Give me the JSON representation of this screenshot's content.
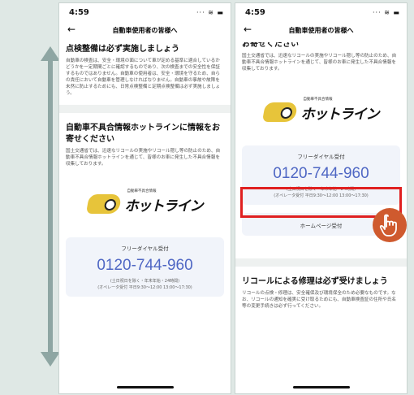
{
  "left_screen": {
    "status_time": "4:59",
    "nav_title": "自動車使用者の皆様へ",
    "section1_title": "点検整備は必ず実施しましょう",
    "section1_body": "自動車の検査は、安全・環境の面について車が定める基準に適合しているかどうかを一定期間ごとに確認するものであり、次の検査までの安全性を保証するものではありません。自動車の使用者は、安全・環境を守るため、自らの責任において自動車を管理しなければなりません。自動車の事故や故障を未然に防止するためにも、日常点検整備と定期点検整備は必ず実施しましょう。",
    "section2_title": "自動車不具合情報ホットラインに情報をお寄せください",
    "section2_body": "国土交通省では、迅速なリコールの実施やリコール隠し等の防止のため、自動車不具合情報ホットラインを通じて、皆様のお車に発生した不具合情報を収集しております。",
    "logo_small": "自動車不具合情報",
    "logo_main": "ホットライン",
    "card_label": "フリーダイヤル受付",
    "phone_number": "0120-744-960",
    "hours_line1": "(土日祝日を除く・年末年始・24時間)",
    "hours_line2": "(オペレータ受付 平日9:30〜12:00 13:00〜17:30)"
  },
  "right_screen": {
    "status_time": "4:59",
    "nav_title": "自動車使用者の皆様へ",
    "top_title": "お寄せください",
    "top_body": "国土交通省では、迅速なリコールの実施やリコール隠し等の防止のため、自動車不具合情報ホットラインを通じて、皆様のお車に発生した不具合情報を収集しております。",
    "logo_small": "自動車不具合情報",
    "logo_main": "ホットライン",
    "card_label": "フリーダイヤル受付",
    "phone_number": "0120-744-960",
    "hours_line1": "(土日祝日を除く・年末年始・24時間)",
    "hours_line2": "(オペレータ受付 平日9:30〜12:00 13:00〜17:30)",
    "home_button": "ホームページ受付",
    "recall_title": "リコールによる修理は必ず受けましょう",
    "recall_body": "リコールの点検・修理は、安全確保及び環境保全のため必要なものです。なお、リコールの通知を確実に受け取るためにも、自動車検査証の住所や氏名等の変更手続きは必ず行ってください。"
  },
  "colors": {
    "accent": "#4f67c4",
    "highlight": "#e02020",
    "tap": "#cf5a2e",
    "background": "#dfe8e5"
  },
  "icons": [
    "back-arrow-icon",
    "signal-wifi-battery-icon",
    "external-link-icon",
    "tap-hand-icon",
    "scroll-arrow-icon"
  ]
}
